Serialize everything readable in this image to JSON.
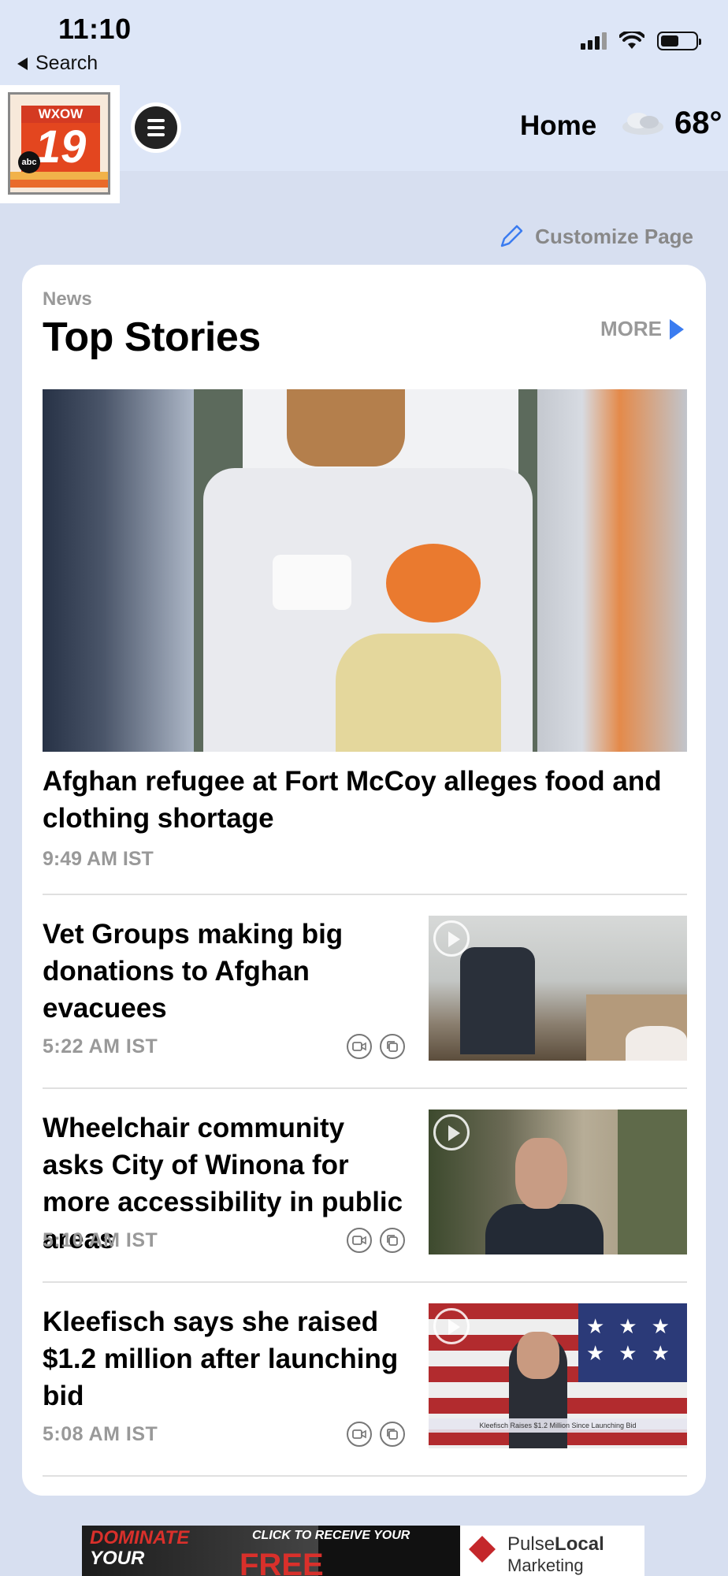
{
  "status_bar": {
    "time": "11:10",
    "back_label": "Search"
  },
  "header": {
    "logo_top": "WXOW",
    "logo_num": "19",
    "logo_network": "abc",
    "home_label": "Home",
    "temperature": "68°"
  },
  "customize_label": "Customize Page",
  "section": {
    "label": "News",
    "title": "Top Stories",
    "more_label": "MORE"
  },
  "lead_story": {
    "title": "Afghan refugee at Fort McCoy alleges food and clothing shortage",
    "time": "9:49 AM IST"
  },
  "stories": [
    {
      "title": "Vet Groups making big donations to Afghan evacuees",
      "time": "5:22 AM IST"
    },
    {
      "title": "Wheelchair community asks City of Winona for more accessibility in public areas",
      "time": "5:10 AM IST"
    },
    {
      "title": "Kleefisch says she raised $1.2 million after launching bid",
      "time": "5:08 AM IST",
      "thumb_caption": "Kleefisch Raises $1.2 Million Since Launching Bid"
    }
  ],
  "ad": {
    "line1": "DOMINATE",
    "line2": "YOUR",
    "cta": "CLICK TO RECEIVE YOUR",
    "free": "FREE",
    "brand_a": "Pulse",
    "brand_b": "Local",
    "brand_sub": "Marketing"
  },
  "colors": {
    "accent": "#3b7cf0",
    "background": "#d7dff0",
    "muted": "#999999"
  }
}
